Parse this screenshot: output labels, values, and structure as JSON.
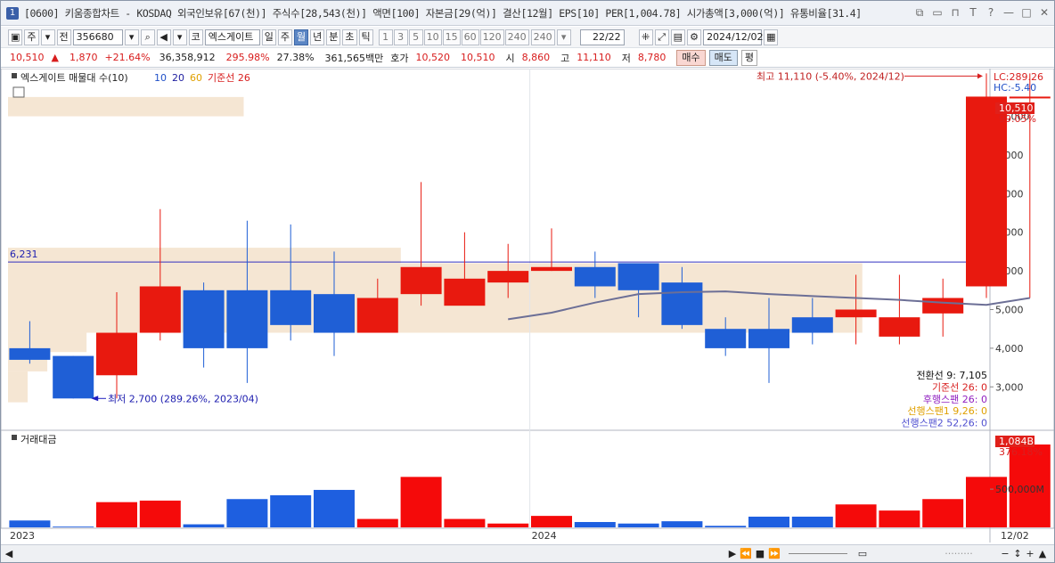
{
  "title": {
    "text": "[0600] 키움종합차트 - KOSDAQ 외국인보유[67(천)] 주식수[28,543(천)] 액면[100] 자본금[29(억)] 결산[12월] EPS[10] PER[1,004.78] 시가총액[3,000(억)] 유통비율[31.4]",
    "number": "1",
    "icons": [
      "restore-icon",
      "link-icon",
      "pin-icon",
      "font-icon",
      "help-icon",
      "minimize-icon",
      "maximize-icon",
      "close-icon"
    ]
  },
  "toolbar": {
    "period_main": "주",
    "all_label": "전",
    "code": "356680",
    "market": "코",
    "name": "엑스게이트",
    "periods": [
      "일",
      "주",
      "월",
      "년",
      "분",
      "초",
      "틱"
    ],
    "selected_period": "월",
    "intervals": [
      "1",
      "3",
      "5",
      "10",
      "15",
      "60",
      "120",
      "240"
    ],
    "interval_value": "240",
    "count": "22/22",
    "date": "2024/12/02"
  },
  "quote": {
    "price": "10,510",
    "arrow": "▲",
    "change": "1,870",
    "change_pct": "+21.64%",
    "volume": "36,358,912",
    "vol_pct": "295.98%",
    "turnover": "27.38%",
    "amount": "361,565백만",
    "bid_label": "호가",
    "bid": "10,520",
    "ask": "10,510",
    "open_label": "시",
    "open": "8,860",
    "high_label": "고",
    "high": "11,110",
    "low_label": "저",
    "low": "8,780",
    "buy": "매수",
    "sell": "매도",
    "avg": "평"
  },
  "legend": {
    "title": "엑스게이트 매물대 수(10)",
    "ma1": "10",
    "ma2": "20",
    "ma3": "60",
    "base": "기준선 26",
    "vol_title": "거래대금"
  },
  "annotations": {
    "high": "최고 11,110 (-5.40%, 2024/12)",
    "low": "최저 2,700 (289.26%, 2023/04)",
    "lc": "LC:289.26",
    "hc": "HC:-5.40",
    "ref_label": "6,231",
    "last_price": "10,510",
    "last_pct": "99.05%",
    "vol_last": "1,084B",
    "vol_pct": "376.18%",
    "ichimoku": [
      "전환선 9: 7,105",
      "기준선 26: 0",
      "후행스팬 26: 0",
      "선행스팬1 9,26: 0",
      "선행스팬2 52,26: 0"
    ]
  },
  "colors": {
    "up": "#e8190f",
    "down": "#1f5fd6",
    "ma": "#6c6f96",
    "ref_line": "#3030c0",
    "vp": "#f5e6d3"
  },
  "chart_data": {
    "type": "candlestick",
    "x": [
      "2023/01",
      "2023/02",
      "2023/03",
      "2023/04",
      "2023/05",
      "2023/06",
      "2023/07",
      "2023/08",
      "2023/09",
      "2023/10",
      "2023/11",
      "2023/12",
      "2024/01",
      "2024/02",
      "2024/03",
      "2024/04",
      "2024/05",
      "2024/06",
      "2024/07",
      "2024/08",
      "2024/09",
      "2024/10",
      "2024/11",
      "2024/12"
    ],
    "open": [
      4000,
      3800,
      3300,
      4400,
      5500,
      5500,
      5500,
      5400,
      4400,
      5400,
      5100,
      5700,
      6000,
      6100,
      6200,
      5700,
      4500,
      4500,
      4800,
      4800,
      4300,
      4900,
      5600,
      10510
    ],
    "high": [
      4700,
      3800,
      5450,
      7600,
      5700,
      7300,
      7200,
      6500,
      5800,
      8300,
      7000,
      6700,
      7100,
      6500,
      6000,
      6100,
      4800,
      5300,
      5300,
      5900,
      5900,
      5800,
      11110,
      11110
    ],
    "low": [
      3600,
      2700,
      2700,
      4200,
      3500,
      3100,
      4200,
      3800,
      4600,
      5100,
      5300,
      5300,
      6000,
      5300,
      4800,
      4500,
      3800,
      3100,
      4100,
      4100,
      4100,
      4300,
      5300,
      5300
    ],
    "close": [
      3700,
      2700,
      4400,
      5600,
      4000,
      4000,
      4600,
      4400,
      5300,
      6100,
      5800,
      6000,
      6100,
      5600,
      5500,
      4600,
      4000,
      4000,
      4400,
      5000,
      4800,
      5300,
      10510,
      10510
    ],
    "volume_b": [
      0.09,
      0.01,
      0.33,
      0.35,
      0.04,
      0.37,
      0.42,
      0.49,
      0.11,
      0.66,
      0.11,
      0.05,
      0.15,
      0.07,
      0.05,
      0.08,
      0.02,
      0.14,
      0.14,
      0.3,
      0.22,
      0.37,
      0.66,
      1.084
    ],
    "ma_x": [
      "2023/12",
      "2024/01",
      "2024/02",
      "2024/03",
      "2024/04",
      "2024/05",
      "2024/06",
      "2024/07",
      "2024/08",
      "2024/09",
      "2024/10",
      "2024/11",
      "2024/12"
    ],
    "ma": [
      4750,
      4920,
      5180,
      5400,
      5450,
      5470,
      5400,
      5350,
      5300,
      5250,
      5180,
      5120,
      5300
    ],
    "reference_line": 6231,
    "y_ticks": [
      3000,
      4000,
      5000,
      6000,
      7000,
      8000,
      9000,
      10000
    ],
    "y_tick_labels": [
      "3,000",
      "4,000",
      "5,000",
      "6,000",
      "7,000",
      "8,000",
      "9,000",
      "10,000"
    ],
    "vol_tick_label": "500,000M",
    "x_labels": [
      "2023",
      "2024",
      "12/02"
    ],
    "volume_profile": [
      {
        "lo": 10000,
        "hi": 10500,
        "len": 0.24
      },
      {
        "lo": 6200,
        "hi": 6600,
        "len": 0.4
      },
      {
        "lo": 4400,
        "hi": 6200,
        "len": 0.87
      },
      {
        "lo": 3900,
        "hi": 4400,
        "len": 0.08
      },
      {
        "lo": 3400,
        "hi": 3900,
        "len": 0.04
      },
      {
        "lo": 2600,
        "hi": 3400,
        "len": 0.02
      }
    ]
  }
}
